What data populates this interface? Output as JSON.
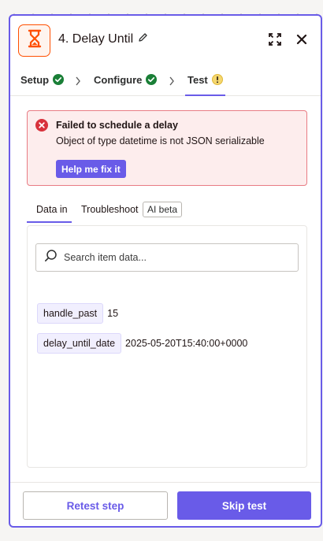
{
  "header": {
    "title": "4. Delay Until",
    "logo_icon": "hourglass-icon",
    "brand_color": "#ff4f00"
  },
  "steps": [
    {
      "label": "Setup",
      "status": "complete"
    },
    {
      "label": "Configure",
      "status": "complete"
    },
    {
      "label": "Test",
      "status": "warning"
    }
  ],
  "error": {
    "title": "Failed to schedule a delay",
    "message": "Object of type datetime is not JSON serializable",
    "fix_label": "Help me fix it"
  },
  "data_tabs": {
    "data_in": "Data in",
    "troubleshoot": "Troubleshoot",
    "ai_badge": "AI beta"
  },
  "search": {
    "placeholder": "Search item data..."
  },
  "fields": [
    {
      "key": "handle_past",
      "value": "15"
    },
    {
      "key": "delay_until_date",
      "value": "2025-05-20T15:40:00+0000"
    }
  ],
  "footer": {
    "retest_label": "Retest step",
    "skip_label": "Skip test"
  },
  "colors": {
    "accent": "#695be8",
    "success": "#1a7f37",
    "warning": "#f5d76e",
    "error": "#d8323c"
  }
}
